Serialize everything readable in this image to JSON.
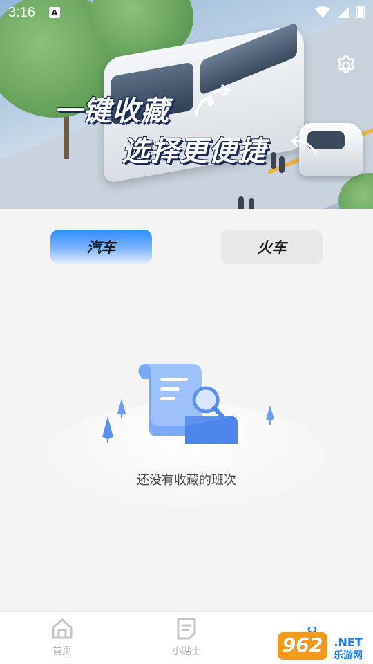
{
  "status_bar": {
    "time": "3:16",
    "notification_icon": "a-letter-icon",
    "right_icons": [
      "wifi-icon",
      "signal-icon",
      "battery-icon"
    ]
  },
  "hero": {
    "line1": "一键收藏",
    "line2": "选择更便捷",
    "settings_icon": "gear-icon"
  },
  "tabs": [
    {
      "label": "汽车",
      "selected": true
    },
    {
      "label": "火车",
      "selected": false
    }
  ],
  "empty_state": {
    "message": "还没有收藏的班次",
    "icon": "document-search-icon"
  },
  "bottom_nav": {
    "items": [
      {
        "label": "首页",
        "icon": "home-icon"
      },
      {
        "label": "小贴士",
        "icon": "note-icon"
      },
      {
        "label": "",
        "icon": "user-icon"
      }
    ]
  },
  "watermark": {
    "top": "962",
    "suffix": ".NET",
    "bottom": "乐游网"
  },
  "colors": {
    "accent_blue": "#2f8cff",
    "tab_inactive": "#e8e8ea",
    "nav_label": "#b4b4b4",
    "background": "#f4f4f5"
  }
}
